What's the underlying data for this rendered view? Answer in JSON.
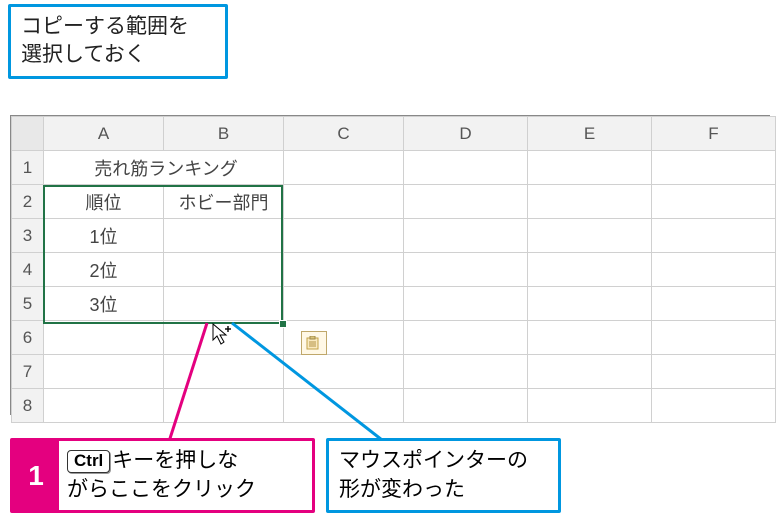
{
  "callouts": {
    "top": "コピーする範囲を\n選択しておく",
    "bottom_left": {
      "step": "1",
      "key": "Ctrl",
      "text": "キーを押しな\nがらここをクリック"
    },
    "bottom_right": "マウスポインターの\n形が変わった"
  },
  "sheet": {
    "columns": [
      "A",
      "B",
      "C",
      "D",
      "E",
      "F"
    ],
    "rows": [
      "1",
      "2",
      "3",
      "4",
      "5",
      "6",
      "7",
      "8"
    ],
    "title": "売れ筋ランキング",
    "header_a": "順位",
    "header_b": "ホビー部門",
    "r1": "1位",
    "r2": "2位",
    "r3": "3位"
  }
}
